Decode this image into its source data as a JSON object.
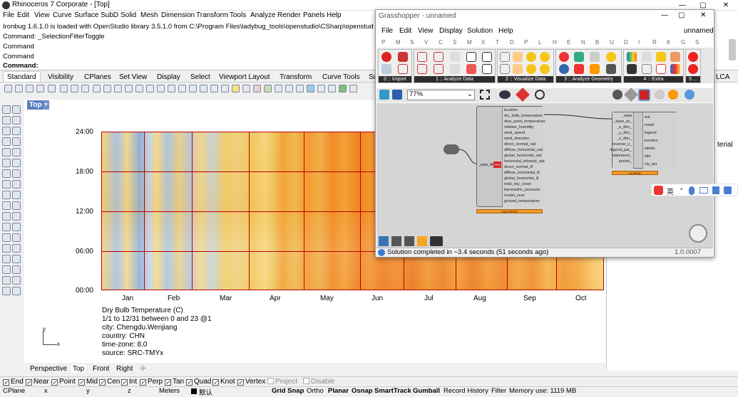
{
  "window": {
    "title": "Rhinoceros 7 Corporate - [Top]",
    "min": "—",
    "max": "▢",
    "close": "✕"
  },
  "menu": [
    "File",
    "Edit",
    "View",
    "Curve",
    "Surface",
    "SubD",
    "Solid",
    "Mesh",
    "Dimension",
    "Transform",
    "Tools",
    "Analyze",
    "Render",
    "Panels",
    "Help"
  ],
  "command_history": [
    "Ironbug 1.6.1.0 is loaded with OpenStudio library 3.5.1.0 from C:\\Program Files\\ladybug_tools\\openstudio\\CSharp\\openstudio.",
    "Command: _SelectionFilterToggle",
    "Command",
    "Command"
  ],
  "command_prompt": "Command:",
  "tabs": [
    "Standard",
    "Visibility",
    "CPlanes",
    "Set View",
    "Display",
    "Select",
    "Viewport Layout",
    "Transform",
    "Curve Tools",
    "Su"
  ],
  "right_partial_tab": "LCA",
  "viewport": {
    "name": "Top",
    "y_ticks": [
      "24:00",
      "18:00",
      "12:00",
      "06:00",
      "00:00"
    ],
    "x_ticks": [
      "Jan",
      "Feb",
      "Mar",
      "Apr",
      "May",
      "Jun",
      "Jul",
      "Aug",
      "Sep",
      "Oct"
    ],
    "legend_lines": [
      "Dry Bulb Temperature (C)",
      "1/1 to 12/31 between 0 and 23 @1",
      "city: Chengdu.Wenjiang",
      "country: CHN",
      "time-zone: 8.0",
      "source: SRC-TMYx"
    ],
    "axis_y": "y",
    "axis_x": "x"
  },
  "viewport_tabs": [
    "Perspective",
    "Top",
    "Front",
    "Right"
  ],
  "osnaps": [
    {
      "label": "End",
      "checked": true
    },
    {
      "label": "Near",
      "checked": true
    },
    {
      "label": "Point",
      "checked": true
    },
    {
      "label": "Mid",
      "checked": true
    },
    {
      "label": "Cen",
      "checked": true
    },
    {
      "label": "Int",
      "checked": true
    },
    {
      "label": "Perp",
      "checked": true
    },
    {
      "label": "Tan",
      "checked": true
    },
    {
      "label": "Quad",
      "checked": true
    },
    {
      "label": "Knot",
      "checked": true
    },
    {
      "label": "Vertex",
      "checked": true
    },
    {
      "label": "Project",
      "checked": false
    },
    {
      "label": "Disable",
      "checked": false
    }
  ],
  "statusbar": {
    "cplane": "CPlane",
    "x": "x",
    "y": "y",
    "z": "z",
    "units": "Meters",
    "layer": "默认",
    "grid_snap": "Grid Snap",
    "ortho": "Ortho",
    "planar": "Planar",
    "osnap": "Osnap",
    "smarttrack": "SmartTrack",
    "gumball": "Gumball",
    "record": "Record History",
    "filter": "Filter",
    "memory": "Memory use: 1119 MB"
  },
  "right_panel_text": "terial",
  "grasshopper": {
    "title": "Grasshopper - unnamed",
    "doc_name": "unnamed",
    "menu": [
      "File",
      "Edit",
      "View",
      "Display",
      "Solution",
      "Help"
    ],
    "categories": [
      "P",
      "M",
      "S",
      "V",
      "C",
      "S",
      "M",
      "X",
      "T",
      "D",
      "P",
      "L",
      "H",
      "E",
      "N",
      "B",
      "U",
      "D",
      "I",
      "R",
      "K",
      "G",
      "S"
    ],
    "ribbon_groups": [
      "0 :: Import",
      "1 :: Analyze Data",
      "2 :: Visualize Data",
      "3 :: Analyze Geometry",
      "4 :: Extra",
      "5 ..."
    ],
    "zoom": "77%",
    "file_param_label": "_epw_file",
    "epw_outputs": [
      "location",
      "dry_bulb_temperature",
      "dew_point_temperature",
      "relative_humidity",
      "wind_speed",
      "wind_direction",
      "direct_normal_rad",
      "diffuse_horizontal_rad",
      "global_horizontal_rad",
      "horizontal_infrared_rad",
      "direct_normal_ill",
      "diffuse_horizontal_ill",
      "global_horizontal_ill",
      "total_sky_cover",
      "barometric_pressure",
      "model_year",
      "ground_temperature"
    ],
    "epw_component_label": "EPW",
    "epw_footer": "ImportEPW",
    "heatmap_inputs": [
      "_data",
      "_base_pt_",
      "_x_dim_",
      "_y_dim_",
      "_z_dim_",
      "reverse_y_",
      "legend_par_",
      "statement_",
      "period_"
    ],
    "heatmap_outputs": [
      "out",
      "mesh",
      "legend",
      "borders",
      "labels",
      "title",
      "vis_set"
    ],
    "heatmap_footer": "HeatMap",
    "status": "Solution completed in ~3.4 seconds (51 seconds ago)",
    "version": "1.0.0007"
  },
  "ime": {
    "label": "英"
  }
}
